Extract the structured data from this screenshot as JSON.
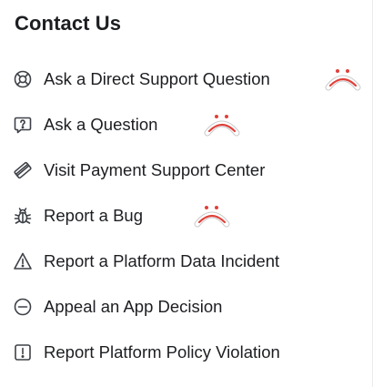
{
  "header": {
    "title": "Contact Us"
  },
  "menu": {
    "items": [
      {
        "label": "Ask a Direct Support Question",
        "icon": "lifebuoy-icon"
      },
      {
        "label": "Ask a Question",
        "icon": "question-bubble-icon"
      },
      {
        "label": "Visit Payment Support Center",
        "icon": "credit-card-icon"
      },
      {
        "label": "Report a Bug",
        "icon": "bug-icon"
      },
      {
        "label": "Report a Platform Data Incident",
        "icon": "warning-triangle-icon"
      },
      {
        "label": "Appeal an App Decision",
        "icon": "minus-circle-icon"
      },
      {
        "label": "Report Platform Policy Violation",
        "icon": "exclamation-square-icon"
      }
    ]
  },
  "stickers": [
    {
      "icon": "sad-face-sticker-icon",
      "item": "Ask a Direct Support Question"
    },
    {
      "icon": "sad-face-sticker-icon",
      "item": "Ask a Question"
    },
    {
      "icon": "sad-face-sticker-icon",
      "item": "Report a Bug"
    }
  ],
  "colors": {
    "text": "#1c1e21",
    "icon": "#3d4147",
    "sticker_stroke": "#e0403a",
    "background": "#ffffff"
  }
}
